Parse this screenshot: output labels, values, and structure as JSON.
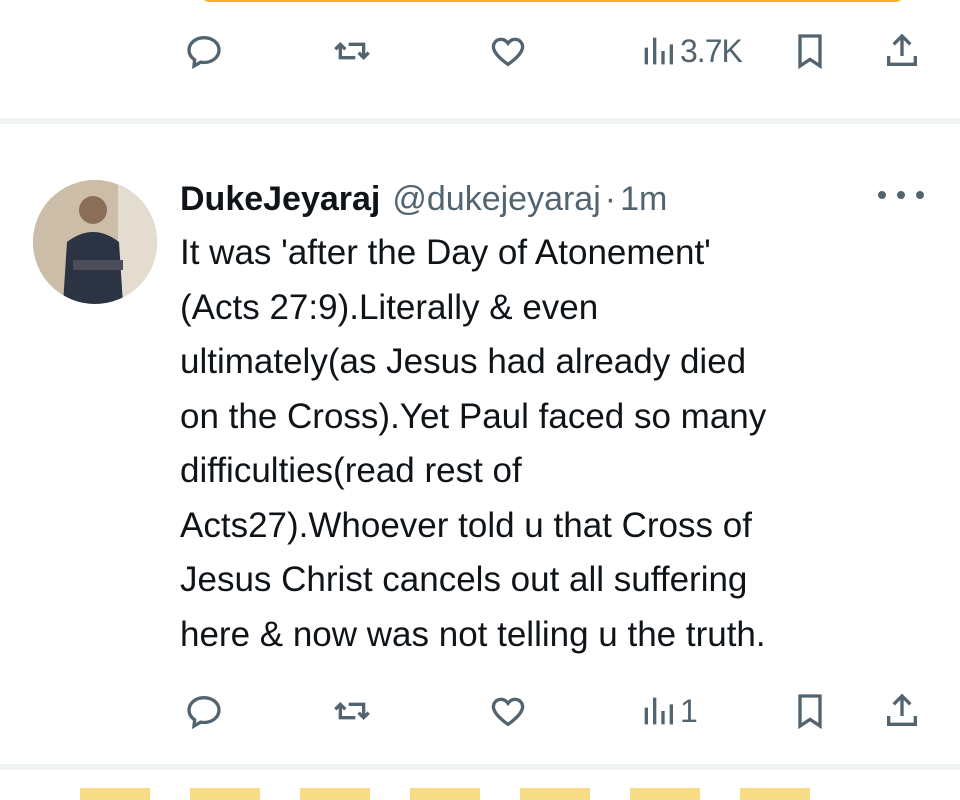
{
  "prev_tweet": {
    "actions": {
      "reply_icon": "reply-icon",
      "retweet_icon": "retweet-icon",
      "like_icon": "like-icon",
      "views_icon": "views-icon",
      "views_count": "3.7K",
      "bookmark_icon": "bookmark-icon",
      "share_icon": "share-icon"
    }
  },
  "tweet": {
    "display_name": "DukeJeyaraj",
    "handle": "@dukejeyaraj",
    "separator": "·",
    "time": "1m",
    "text": "It was 'after the Day of Atonement'\n(Acts 27:9).Literally & even\nultimately(as Jesus had already died\non the Cross).Yet Paul faced so many\ndifficulties(read rest of\nActs27).Whoever told u that Cross of\nJesus Christ cancels out all suffering\nhere & now was not telling u the truth.",
    "actions": {
      "views_count": "1"
    }
  },
  "colors": {
    "text": "#0f1419",
    "secondary": "#536471",
    "divider": "#eff3f4",
    "accent_yellow": "#f5b31a"
  }
}
